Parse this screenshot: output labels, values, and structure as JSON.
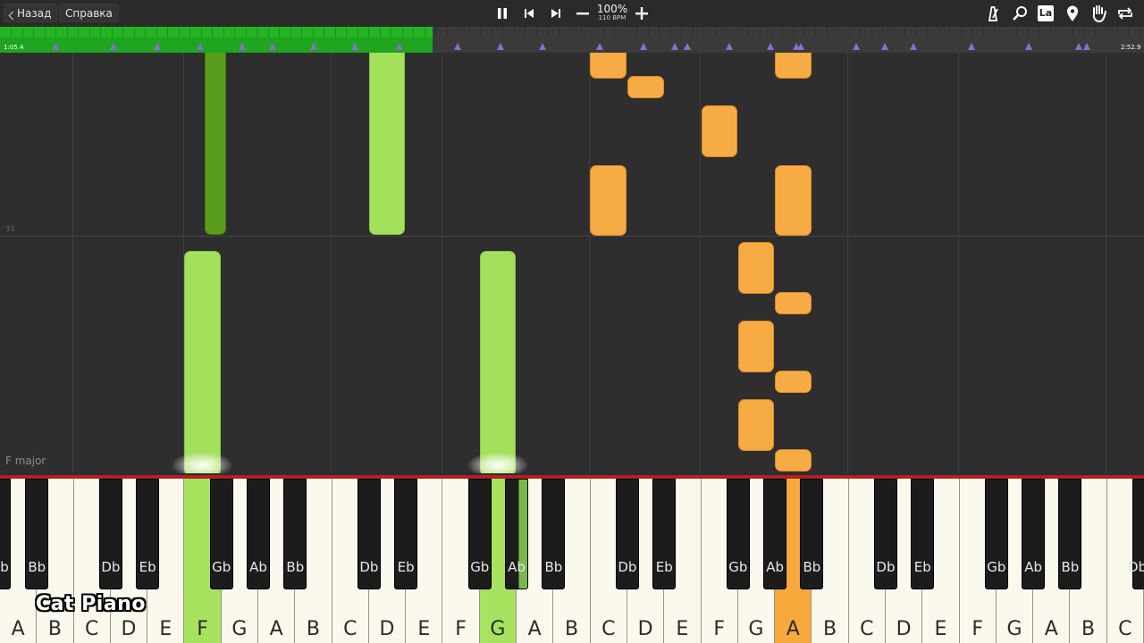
{
  "toolbar": {
    "back_label": "Назад",
    "help_label": "Справка",
    "zoom": "100%",
    "bpm": "110 BPM",
    "la_label": "La",
    "icons": [
      "pause-icon",
      "skip-back-icon",
      "skip-forward-icon",
      "minus-icon",
      "plus-icon",
      "metronome-icon",
      "search-icon",
      "label-icon",
      "location-pin-icon",
      "hand-icon",
      "loop-icon"
    ]
  },
  "progress": {
    "time_elapsed": "1:05.4",
    "time_total": "2:52.9",
    "fraction": 0.378
  },
  "roll": {
    "measure_number": "33",
    "key_signature": "F major"
  },
  "keyboard": {
    "white_keys": [
      "A",
      "B",
      "C",
      "D",
      "E",
      "F",
      "G",
      "A",
      "B",
      "C",
      "D",
      "E",
      "F",
      "G",
      "A",
      "B",
      "C",
      "D",
      "E",
      "F",
      "G",
      "A",
      "B",
      "C",
      "D",
      "E",
      "F",
      "G",
      "A",
      "B",
      "C"
    ],
    "black_keys": [
      "Bb",
      "Db",
      "Eb",
      "Gb",
      "Ab",
      "Bb",
      "Db",
      "Eb",
      "Gb",
      "Ab",
      "Bb",
      "Db",
      "Eb",
      "Gb",
      "Ab",
      "Bb",
      "Db",
      "Eb",
      "Gb",
      "Ab",
      "Bb",
      "Db"
    ],
    "edge_left_black": "b",
    "pressed": [
      "F",
      "G",
      "A"
    ]
  },
  "watermark": "Cat Piano",
  "colors": {
    "progress_green": "#1fa51f",
    "right_hand_green": "#a3e05c",
    "right_hand_dark": "#5a9d1c",
    "left_hand_orange": "#f7ab45",
    "marker_purple": "#8f6bd1",
    "hit_line": "#b32020"
  }
}
